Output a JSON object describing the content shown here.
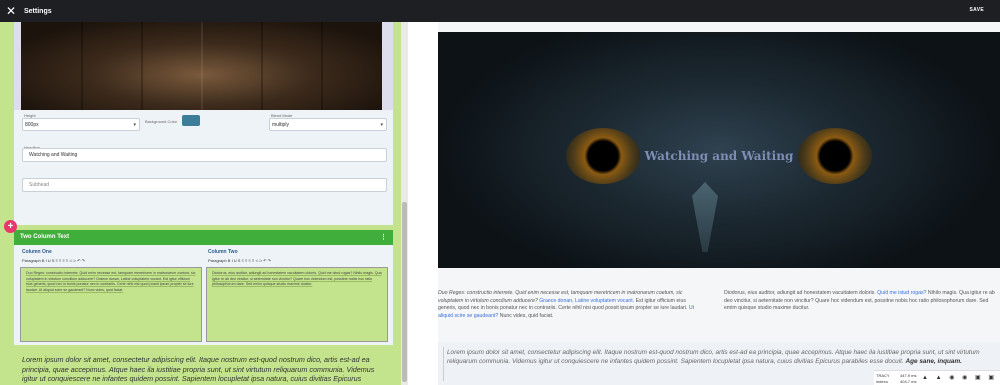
{
  "window": {
    "close": "✕",
    "title": "Settings",
    "save": "SAVE"
  },
  "hero_fields": {
    "height_label": "Height",
    "height_value": "800px",
    "bg_label": "Background Color",
    "blend_label": "Blend Mode",
    "blend_value": "multiply",
    "headline_label": "Headline",
    "headline_value": "Watching and Waiting",
    "subhead_placeholder": "Subhead",
    "accent_color": "#3c7d9a"
  },
  "two_column": {
    "title": "Two Column Text",
    "col_one_label": "Column One",
    "col_two_label": "Column Two",
    "toolbar": "Paragraph  B  I  U  S  ≡  ≡  ≡  ≡  ⊂⊃  ↶  ↷",
    "col_one_text": "Duo Reges: constructio interrete. Quid enim necesse est, tamquam meretricem in matronarum coetum, sic voluptatem in virtutum concilium adducere? Graece donan, Latine voluptatem vocant. Est igitur officium eius generis, quod nec in bonis ponatur nec in contrariis. Certe nihil nisi quod possit ipsum propter se iure laudari. Ut aliquid scire se gaudeant? Nunc vides, quid faciat.",
    "col_two_text": "Diodorus, eius auditor, adiungit ad honestatem vacuitatem doloris. Quid me istud rogas? Nihilo magis. Qua igitur re ab deo vincitur, si aeternitate non vincitur? Quare hoc videndum est, possitne nobis hoc ratio philosophorum dare. Sed emim quisque studio maxime ducitur."
  },
  "editor_text": "Lorem ipsum dolor sit amet, consectetur adipiscing elit. Itaque nostrum est-quod nostrum dico, artis est-ad ea principia, quae accepimus. Atque haec ila iustitiae propria sunt, ut sint virtutum reliquarum communia. Videmus igitur ut conquiescere ne infantes quidem possint. Sapientem locupletat ipsa natura, cuius divitias Epicurus parabiles esse docuit.",
  "preview": {
    "headline": "Watching and Waiting",
    "col1_a": "Duo Reges: constructio interrete. Quid enim necesse est, tamquam meretricem in matronarum coetum, sic voluptatem in virtutum concilium adducere?",
    "col1_link": "Graece donan, Latine voluptatem vocant.",
    "col1_b": "Est igitur officium eius generis, quod nec in bonis ponatur nec in contrariis. Certe nihil nisi quod possit ipsum propter se iure laudari.",
    "col1_link2": "Ut aliquid scire se gaudeant?",
    "col1_c": "Nunc vides, quid faciat.",
    "col2_a": "Diodorus, eius auditor, adiungit ad honestatem vacuitatem doloris.",
    "col2_link": "Quid me istud rogas?",
    "col2_b": "Nihilo magis. Qua igitur re ab deo vincitur, si aeternitate non vincitur? Quare hoc videndum est, possitne nobis hoc ratio philosophorum dare. Sed emim quisque studio maxime ducitur.",
    "quote": "Lorem ipsum dolor sit amet, consectetur adipiscing elit. Itaque nostrum est-quod nostrum dico, artis est-ad ea principia, quae accepimus. Atque haec ila iustitiae propria sunt, ut sint virtutum reliquarum communia. Videmus igitur ut conquiescere ne infantes quidem possint. Sapientem locupletat ipsa natura, cuius divitias Epicurus parabiles esse docuit.",
    "quote_bold": "Age sane, inquam."
  },
  "tray": {
    "a": "TRACY",
    "b": "indexo",
    "c": "447.9 ms",
    "d": "404.7 ms"
  }
}
